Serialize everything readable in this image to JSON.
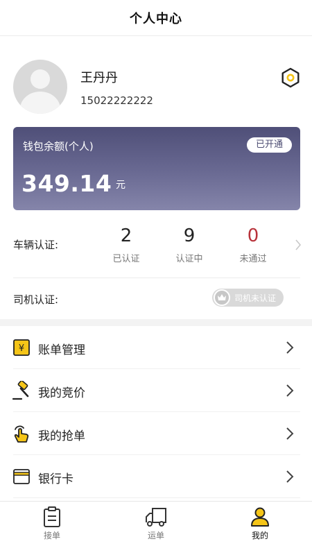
{
  "header": {
    "title": "个人中心"
  },
  "profile": {
    "name": "王丹丹",
    "phone": "15022222222",
    "settings_icon": "hexagon-settings-icon"
  },
  "wallet": {
    "label": "钱包余额(个人)",
    "badge": "已开通",
    "amount": "349.14",
    "unit": "元"
  },
  "vehicle_cert": {
    "label": "车辆认证:",
    "stats": [
      {
        "value": "2",
        "caption": "已认证"
      },
      {
        "value": "9",
        "caption": "认证中"
      },
      {
        "value": "0",
        "caption": "未通过",
        "color": "#b8333b"
      }
    ]
  },
  "driver_cert": {
    "label": "司机认证:",
    "status": "司机未认证"
  },
  "menu": {
    "items": [
      {
        "label": "账单管理",
        "icon": "bill-icon"
      },
      {
        "label": "我的竞价",
        "icon": "gavel-icon"
      },
      {
        "label": "我的抢单",
        "icon": "hand-tap-icon"
      },
      {
        "label": "银行卡",
        "icon": "bank-card-icon"
      }
    ]
  },
  "tabbar": {
    "tabs": [
      {
        "label": "接单",
        "icon": "clipboard-icon"
      },
      {
        "label": "运单",
        "icon": "truck-icon"
      },
      {
        "label": "我的",
        "icon": "user-icon",
        "active": true
      }
    ]
  },
  "colors": {
    "accent_yellow": "#f5c518",
    "wallet_top": "#4f4f78",
    "wallet_bottom": "#8585aa",
    "rejected_red": "#b8333b"
  }
}
